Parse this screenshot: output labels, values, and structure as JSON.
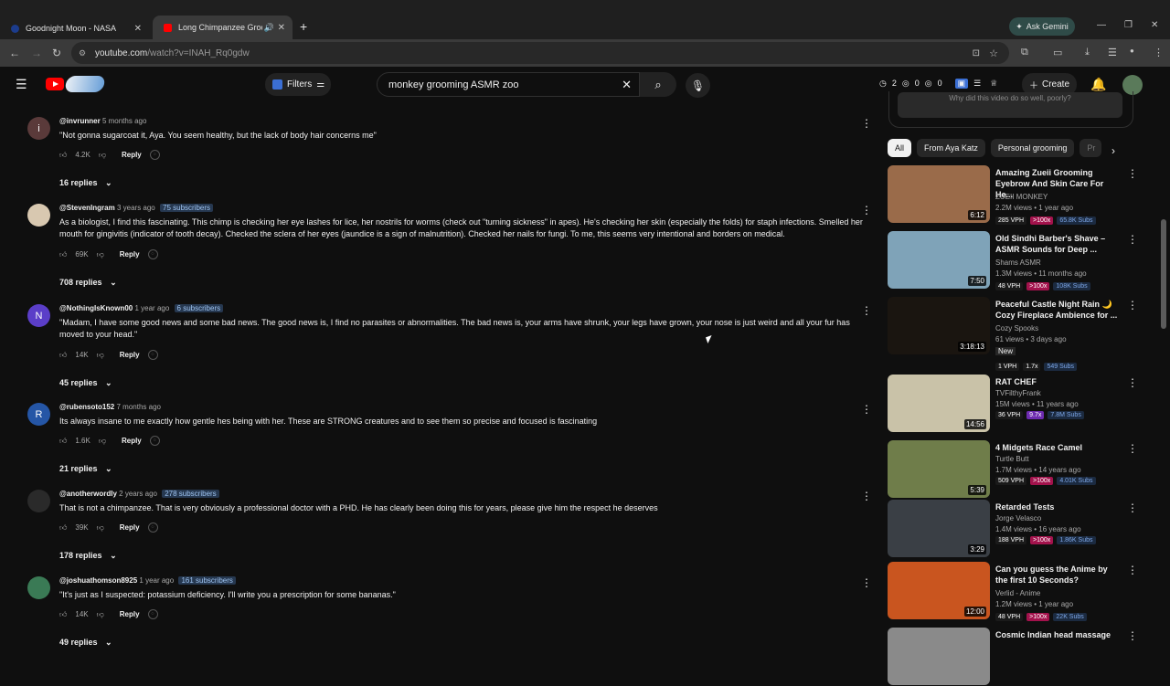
{
  "browser": {
    "tabs": [
      {
        "title": "Goodnight Moon - NASA"
      },
      {
        "title": "Long Chimpanzee Grooming"
      }
    ],
    "gemini_label": "Ask Gemini",
    "url_host": "youtube.com",
    "url_path": "/watch?v=INAH_Rq0gdw"
  },
  "header": {
    "filters_label": "Filters",
    "search_value": "monkey grooming ASMR zoo",
    "stats": [
      "2",
      "0",
      "0"
    ],
    "create_label": "Create"
  },
  "ai_prompt": "Why did this video do so well, poorly?",
  "chips": [
    "All",
    "From Aya Katz",
    "Personal grooming",
    "Pr"
  ],
  "comments": [
    {
      "handle": "@invrunner",
      "time": "5 months ago",
      "subs": "",
      "initial": "i",
      "text": "\"Not gonna sugarcoat it, Aya. You seem healthy, but the lack of body hair concerns me\"",
      "likes": "4.2K",
      "reply": "Reply",
      "replies": "16 replies"
    },
    {
      "handle": "@StevenIngram",
      "time": "3 years ago",
      "subs": "75 subscribers",
      "initial": "",
      "text": "As a biologist, I find this fascinating. This chimp is checking her eye lashes for lice, her nostrils for worms (check out \"turning sickness\" in apes). He's checking her skin (especially the folds) for staph infections. Smelled her mouth for gingivitis (indicator of tooth decay). Checked the sclera of her eyes (jaundice is a sign of malnutrition). Checked her nails for fungi. To me, this seems very intentional and borders on medical.",
      "likes": "69K",
      "reply": "Reply",
      "replies": "708 replies"
    },
    {
      "handle": "@NothingIsKnown00",
      "time": "1 year ago",
      "subs": "6 subscribers",
      "initial": "N",
      "text": "\"Madam, I have some good news and some bad news. The good news is, I find no parasites or abnormalities. The bad news is, your arms have shrunk, your legs have grown, your nose is just weird and all your fur has moved to your head.\"",
      "likes": "14K",
      "reply": "Reply",
      "replies": "45 replies"
    },
    {
      "handle": "@rubensoto152",
      "time": "7 months ago",
      "subs": "",
      "initial": "R",
      "text": "Its always insane to me exactly how gentle hes being with her. These are STRONG creatures and to see them so precise and focused is fascinating",
      "likes": "1.6K",
      "reply": "Reply",
      "replies": "21 replies"
    },
    {
      "handle": "@anotherwordly",
      "time": "2 years ago",
      "subs": "278 subscribers",
      "initial": "",
      "text": "That is not a chimpanzee. That is very obviously a professional doctor with a PHD. He has clearly been doing this for years, please give him the respect he deserves",
      "likes": "39K",
      "reply": "Reply",
      "replies": "178 replies"
    },
    {
      "handle": "@joshuathomson8925",
      "time": "1 year ago",
      "subs": "161 subscribers",
      "initial": "",
      "text": "\"It's just as I suspected: potassium deficiency. I'll write you a prescription for some bananas.\"",
      "likes": "14K",
      "reply": "Reply",
      "replies": "49 replies"
    }
  ],
  "videos": [
    {
      "title": "Amazing Zueii Grooming Eyebrow And Skin Care For He...",
      "channel": "ZUEII MONKEY",
      "meta": "2.2M views • 1 year ago",
      "duration": "6:12",
      "vph": "285 VPH",
      "ratio": ">100x",
      "subs": "65.8K Subs",
      "thumb": "#9a6b4a"
    },
    {
      "title": "Old Sindhi Barber's Shave – ASMR Sounds for Deep ...",
      "channel": "Shams ASMR",
      "meta": "1.3M views • 11 months ago",
      "duration": "7:50",
      "vph": "48 VPH",
      "ratio": ">100x",
      "subs": "108K Subs",
      "thumb": "#7fa3b8"
    },
    {
      "title": "Peaceful Castle Night Rain 🌙 Cozy Fireplace Ambience for ...",
      "channel": "Cozy Spooks",
      "meta": "61 views • 3 days ago",
      "duration": "3:18:13",
      "badge": "New",
      "vph": "1 VPH",
      "ratio": "1.7x",
      "subs": "549 Subs",
      "thumb": "#1a1510"
    },
    {
      "title": "RAT CHEF",
      "channel": "TVFilthyFrank",
      "meta": "15M views • 11 years ago",
      "duration": "14:56",
      "vph": "36 VPH",
      "ratio": "9.7x",
      "subs": "7.8M Subs",
      "thumb": "#c9c2a8"
    },
    {
      "title": "4 Midgets Race Camel",
      "channel": "Turtle Butt",
      "meta": "1.7M views • 14 years ago",
      "duration": "5:39",
      "vph": "509 VPH",
      "ratio": ">100x",
      "subs": "4.01K Subs",
      "thumb": "#6f7d4a"
    },
    {
      "title": "Retarded Tests",
      "channel": "Jorge Velasco",
      "meta": "1.4M views • 16 years ago",
      "duration": "3:29",
      "vph": "188 VPH",
      "ratio": ">100x",
      "subs": "1.86K Subs",
      "thumb": "#3a3f45"
    },
    {
      "title": "Can you guess the Anime by the first 10 Seconds?",
      "channel": "Verlid - Anime",
      "meta": "1.2M views • 1 year ago",
      "duration": "12:00",
      "vph": "48 VPH",
      "ratio": ">100x",
      "subs": "22K Subs",
      "thumb": "#c9551f"
    },
    {
      "title": "Cosmic Indian head massage",
      "channel": "",
      "meta": "",
      "duration": "",
      "vph": "",
      "ratio": "",
      "subs": "",
      "thumb": "#8a8a8a"
    }
  ]
}
